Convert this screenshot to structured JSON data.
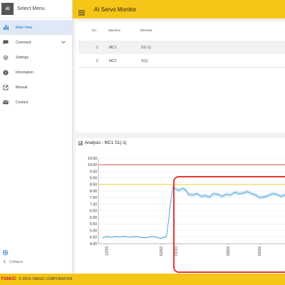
{
  "sidebar": {
    "title": "Select Menu",
    "items": [
      {
        "label": "Main View",
        "icon": "bar-chart-icon"
      },
      {
        "label": "Comment",
        "icon": "comment-icon"
      },
      {
        "label": "Settings",
        "icon": "gear-icon"
      },
      {
        "label": "Information",
        "icon": "info-icon"
      },
      {
        "label": "Manual",
        "icon": "external-link-icon"
      },
      {
        "label": "Contact",
        "icon": "mail-icon"
      }
    ],
    "collapse_label": "Collapse"
  },
  "header": {
    "title": "AI Servo Monitor"
  },
  "table": {
    "headers": [
      "No.",
      "Machine",
      "Element"
    ],
    "rows": [
      {
        "no": "1",
        "machine": "MC1",
        "element": "S1(-1)"
      },
      {
        "no": "2",
        "machine": "MC2",
        "element": "X(1)"
      }
    ]
  },
  "analysis": {
    "title": "Analysis - MC1 S1(-1)"
  },
  "colors": {
    "accent": "#f5c518",
    "active": "#1a73c8",
    "alarm": "#d63b2f",
    "warning": "#f0c419",
    "series": "#4a9fd8",
    "highlight": "#e53935"
  },
  "chart_data": {
    "type": "line",
    "title": "Analysis - MC1 S1(-1)",
    "xlabel": "",
    "ylabel": "",
    "ylim": [
      4.0,
      10.5
    ],
    "yticks": [
      "10.50",
      "10.00",
      "9.50",
      "9.00",
      "8.50",
      "8.00",
      "7.50",
      "7.00",
      "6.50",
      "6.00",
      "5.50",
      "5.00",
      "4.50",
      "4.00"
    ],
    "xticks": [
      "12/16",
      "01/02",
      "01/16",
      "02/02",
      "02/16"
    ],
    "thresholds": [
      {
        "value": 10.0,
        "color": "#d63b2f"
      },
      {
        "value": 8.5,
        "color": "#f0c419"
      }
    ],
    "series": [
      {
        "values": [
          {
            "x": 0.0,
            "y": 4.45
          },
          {
            "x": 0.04,
            "y": 4.55
          },
          {
            "x": 0.08,
            "y": 4.48
          },
          {
            "x": 0.12,
            "y": 4.55
          },
          {
            "x": 0.16,
            "y": 4.5
          },
          {
            "x": 0.2,
            "y": 4.55
          },
          {
            "x": 0.24,
            "y": 4.52
          },
          {
            "x": 0.28,
            "y": 4.5
          },
          {
            "x": 0.32,
            "y": 4.55
          },
          {
            "x": 0.36,
            "y": 4.48
          },
          {
            "x": 0.4,
            "y": 4.45
          },
          {
            "x": 0.44,
            "y": 4.5
          },
          {
            "x": 0.48,
            "y": 4.55
          },
          {
            "x": 0.52,
            "y": 4.48
          },
          {
            "x": 0.55,
            "y": 4.4
          },
          {
            "x": 0.57,
            "y": 4.45
          },
          {
            "x": 0.6,
            "y": 4.5
          },
          {
            "x": 0.61,
            "y": 4.6
          },
          {
            "x": 0.63,
            "y": 5.8
          },
          {
            "x": 0.65,
            "y": 7.2
          },
          {
            "x": 0.67,
            "y": 8.3
          },
          {
            "x": 0.7,
            "y": 8.15
          },
          {
            "x": 0.73,
            "y": 8.05
          },
          {
            "x": 0.76,
            "y": 8.2
          },
          {
            "x": 0.79,
            "y": 8.1
          },
          {
            "x": 0.82,
            "y": 7.75
          },
          {
            "x": 0.86,
            "y": 7.7
          },
          {
            "x": 0.9,
            "y": 7.8
          },
          {
            "x": 0.94,
            "y": 7.6
          },
          {
            "x": 0.98,
            "y": 7.65
          },
          {
            "x": 1.02,
            "y": 7.55
          },
          {
            "x": 1.06,
            "y": 7.8
          },
          {
            "x": 1.1,
            "y": 7.75
          },
          {
            "x": 1.14,
            "y": 7.6
          },
          {
            "x": 1.18,
            "y": 7.75
          },
          {
            "x": 1.22,
            "y": 7.7
          },
          {
            "x": 1.26,
            "y": 7.9
          },
          {
            "x": 1.3,
            "y": 7.8
          },
          {
            "x": 1.34,
            "y": 7.85
          },
          {
            "x": 1.38,
            "y": 7.95
          },
          {
            "x": 1.42,
            "y": 7.8
          },
          {
            "x": 1.46,
            "y": 7.7
          },
          {
            "x": 1.5,
            "y": 7.5
          },
          {
            "x": 1.54,
            "y": 7.55
          },
          {
            "x": 1.58,
            "y": 7.65
          },
          {
            "x": 1.62,
            "y": 7.8
          },
          {
            "x": 1.66,
            "y": 7.75
          },
          {
            "x": 1.7,
            "y": 7.6
          },
          {
            "x": 1.74,
            "y": 7.7
          }
        ]
      }
    ]
  },
  "footer": {
    "brand": "FANUC",
    "copyright": "© 2019- FANUC CORPORATION"
  }
}
